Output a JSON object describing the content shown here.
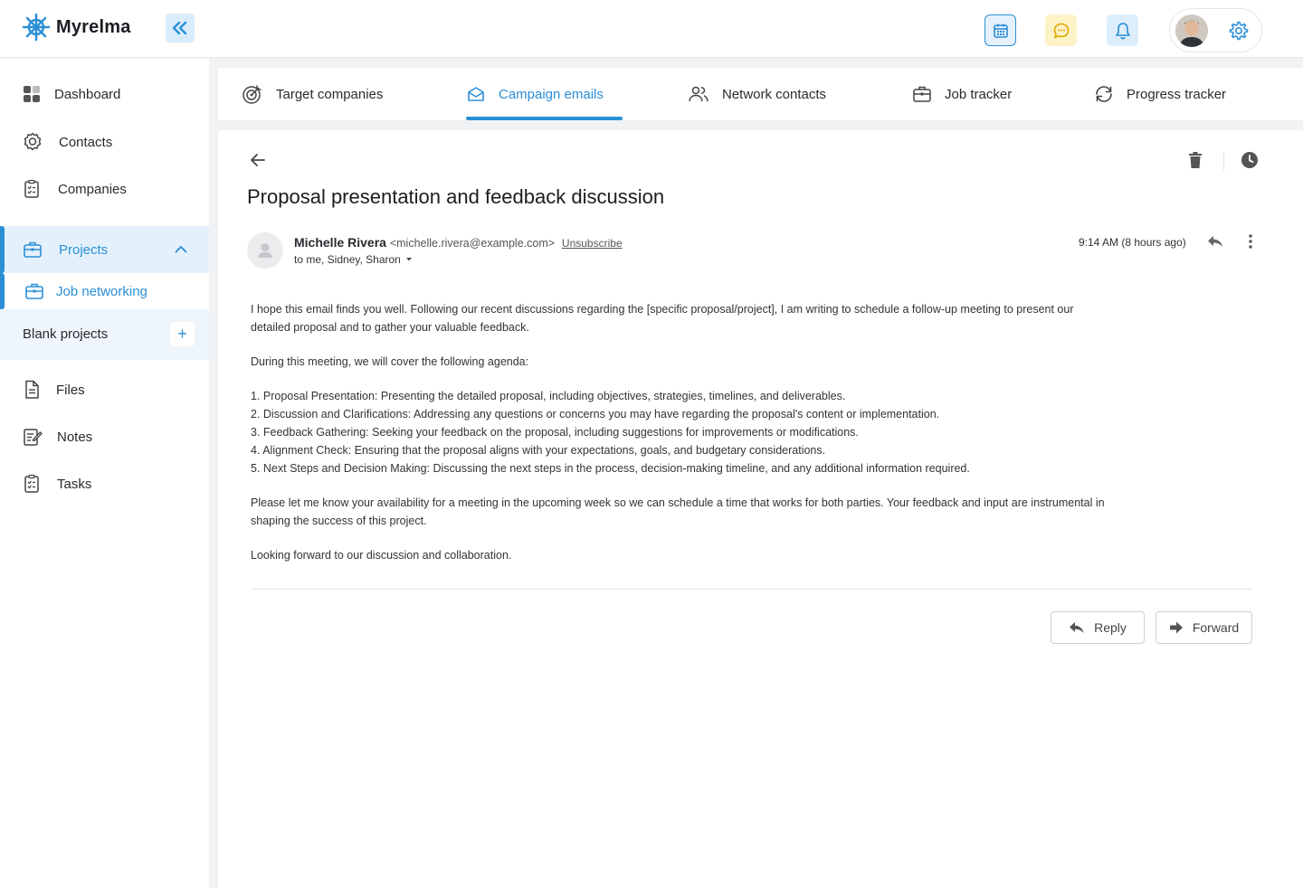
{
  "app": {
    "name": "Myrelma",
    "brand_color": "#2b8fd6"
  },
  "topbar": {
    "icons": [
      "calendar-icon",
      "chat-icon",
      "bell-icon",
      "gear-icon"
    ]
  },
  "sidebar": {
    "items": [
      {
        "label": "Dashboard",
        "icon": "dashboard-icon"
      },
      {
        "label": "Contacts",
        "icon": "contacts-icon"
      },
      {
        "label": "Companies",
        "icon": "clipboard-icon"
      },
      {
        "label": "Projects",
        "icon": "briefcase-icon"
      },
      {
        "label": "Files",
        "icon": "file-icon"
      },
      {
        "label": "Notes",
        "icon": "notes-icon"
      },
      {
        "label": "Tasks",
        "icon": "clipboard-icon"
      }
    ],
    "sub": {
      "job_networking": "Job networking",
      "blank_projects": "Blank projects",
      "add_symbol": "+"
    }
  },
  "tabs": [
    {
      "label": "Target companies",
      "icon": "target-icon"
    },
    {
      "label": "Campaign emails",
      "icon": "mail-icon",
      "active": true
    },
    {
      "label": "Network contacts",
      "icon": "people-icon"
    },
    {
      "label": "Job tracker",
      "icon": "briefcase-icon"
    },
    {
      "label": "Progress tracker",
      "icon": "refresh-icon"
    }
  ],
  "email": {
    "subject": "Proposal presentation and feedback discussion",
    "sender_name": "Michelle Rivera",
    "sender_email": "<michelle.rivera@example.com>",
    "unsubscribe": "Unsubscribe",
    "to_line": "to me, Sidney, Sharon",
    "timestamp": "9:14 AM (8 hours ago)",
    "body": {
      "p1": "I hope this email finds you well. Following our recent discussions regarding the [specific proposal/project], I am writing to schedule a follow-up meeting to present our detailed proposal and to gather your valuable feedback.",
      "p2": "During this meeting, we will cover the following agenda:",
      "agenda": [
        "1. Proposal Presentation: Presenting the detailed proposal, including objectives, strategies, timelines, and deliverables.",
        "2. Discussion and Clarifications: Addressing any questions or concerns you may have regarding the proposal's content or implementation.",
        "3. Feedback Gathering: Seeking your feedback on the proposal, including suggestions for improvements or modifications.",
        "4. Alignment Check: Ensuring that the proposal aligns with your expectations, goals, and budgetary considerations.",
        "5. Next Steps and Decision Making: Discussing the next steps in the process, decision-making timeline, and any additional information required."
      ],
      "p3": "Please let me know your availability for a meeting in the upcoming week so we can schedule a time that works for both parties. Your feedback and input are instrumental in shaping the success of this project.",
      "p4": "Looking forward to our discussion and collaboration."
    },
    "reply_label": "Reply",
    "forward_label": "Forward"
  }
}
